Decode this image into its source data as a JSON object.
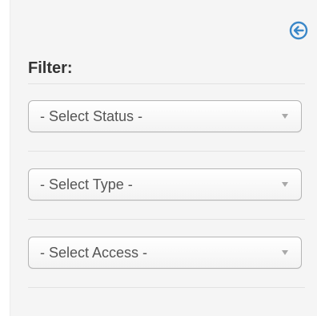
{
  "filter": {
    "title": "Filter:",
    "collapse_icon": "arrow-left-circle-icon",
    "accent_color": "#3a87c8",
    "selects": [
      {
        "selected": "- Select Status -"
      },
      {
        "selected": "- Select Type -"
      },
      {
        "selected": "- Select Access -"
      }
    ]
  }
}
